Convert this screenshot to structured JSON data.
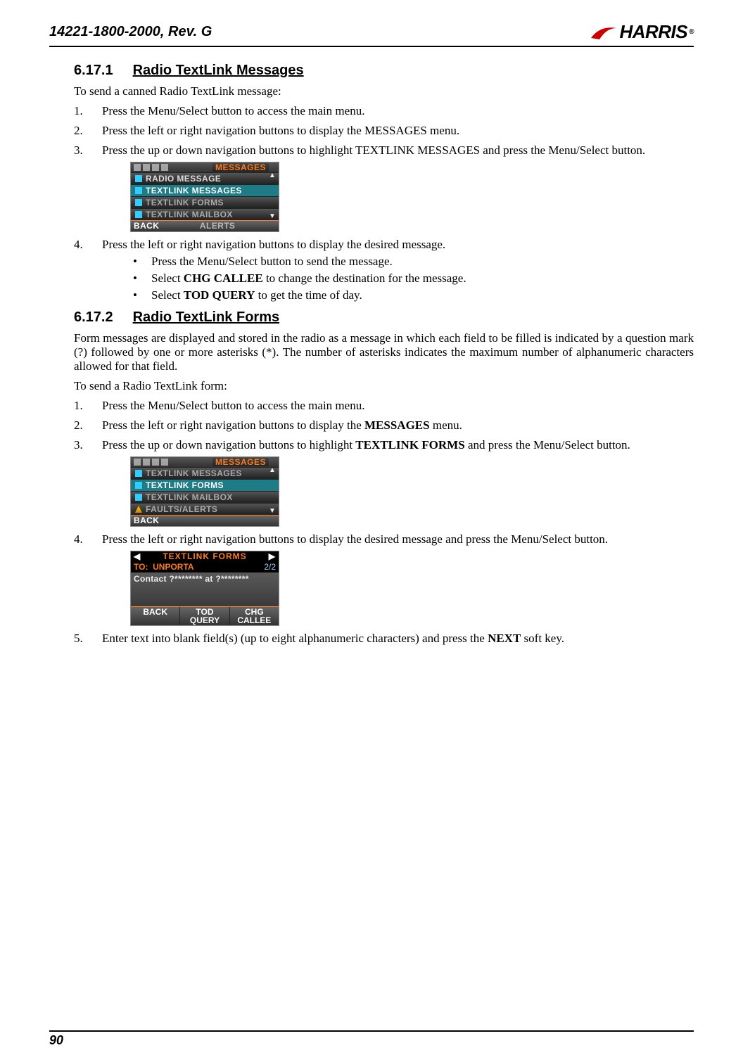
{
  "header": {
    "docnum": "14221-1800-2000, Rev. G",
    "brand": "HARRIS"
  },
  "page_num": "90",
  "s1": {
    "num": "6.17.1",
    "title": "Radio TextLink Messages",
    "intro": "To send a canned Radio TextLink message:",
    "li1": "Press the Menu/Select button to access the main menu.",
    "li2": "Press the left or right navigation buttons to display the MESSAGES menu.",
    "li3": "Press the up or down navigation buttons to highlight TEXTLINK MESSAGES and press the Menu/Select button.",
    "li4": "Press the left or right navigation buttons to display the desired message.",
    "b1": "Press the Menu/Select button to send the message.",
    "b2a": "Select ",
    "b2b": "CHG CALLEE",
    "b2c": " to change the destination for the message.",
    "b3a": "Select ",
    "b3b": "TOD QUERY",
    "b3c": " to get the time of day."
  },
  "screen1": {
    "header": "MESSAGES",
    "r1": "RADIO MESSAGE",
    "r2": "TEXTLINK MESSAGES",
    "r3": "TEXTLINK FORMS",
    "r4": "TEXTLINK MAILBOX",
    "r5": "ALERTS",
    "back": "BACK"
  },
  "s2": {
    "num": "6.17.2",
    "title": "Radio TextLink Forms",
    "para": "Form messages are displayed and stored in the radio as a message in which each field to be filled is indicated by a question mark (?) followed by one or more asterisks (*). The number of asterisks indicates the maximum number of alphanumeric characters allowed for that field.",
    "intro": "To send a Radio TextLink form:",
    "li1": "Press the Menu/Select button to access the main menu.",
    "li2a": "Press the left or right navigation buttons to display the ",
    "li2b": "MESSAGES",
    "li2c": " menu.",
    "li3a": "Press the up or down navigation buttons to highlight ",
    "li3b": "TEXTLINK FORMS",
    "li3c": " and press the Menu/Select button.",
    "li4": "Press the left or right navigation buttons to display the desired message and press the Menu/Select button.",
    "li5a": "Enter text into blank field(s) (up to eight alphanumeric characters) and press the ",
    "li5b": "NEXT",
    "li5c": " soft key."
  },
  "screen2": {
    "header": "MESSAGES",
    "r1": "TEXTLINK MESSAGES",
    "r2": "TEXTLINK FORMS",
    "r3": "TEXTLINK MAILBOX",
    "r4": "FAULTS/ALERTS",
    "back": "BACK"
  },
  "screen3": {
    "header": "TEXTLINK FORMS",
    "to_label": "TO:",
    "to_val": "UNPORTA",
    "page": "2/2",
    "body": "Contact  ?********  at  ?********",
    "f1": "BACK",
    "f2": "TOD QUERY",
    "f3": "CHG CALLEE"
  }
}
